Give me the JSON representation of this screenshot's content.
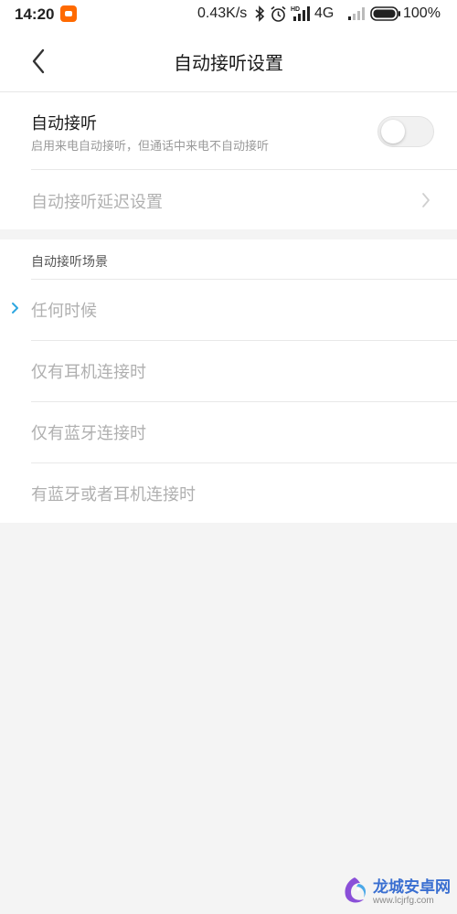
{
  "status_bar": {
    "time": "14:20",
    "net_speed": "0.43K/s",
    "network_type": "4G",
    "battery": "100%",
    "icons": [
      "app-notification-icon",
      "bluetooth-icon",
      "alarm-icon",
      "hd-signal-icon",
      "signal-icon",
      "battery-icon"
    ]
  },
  "header": {
    "title": "自动接听设置",
    "back_icon": "chevron-left-icon"
  },
  "auto_answer": {
    "title": "自动接听",
    "subtitle": "启用来电自动接听，但通话中来电不自动接听",
    "enabled": false
  },
  "delay_setting": {
    "label": "自动接听延迟设置",
    "chevron_icon": "chevron-right-icon"
  },
  "scenes": {
    "header": "自动接听场景",
    "items": [
      {
        "label": "任何时候",
        "selected": true
      },
      {
        "label": "仅有耳机连接时",
        "selected": false
      },
      {
        "label": "仅有蓝牙连接时",
        "selected": false
      },
      {
        "label": "有蓝牙或者耳机连接时",
        "selected": false
      }
    ]
  },
  "watermark": {
    "name": "龙城安卓网",
    "url": "www.lcjrfg.com"
  },
  "colors": {
    "accent": "#2ea7e0",
    "disabled_text": "#b0b0b0",
    "page_background": "#f4f4f4"
  }
}
